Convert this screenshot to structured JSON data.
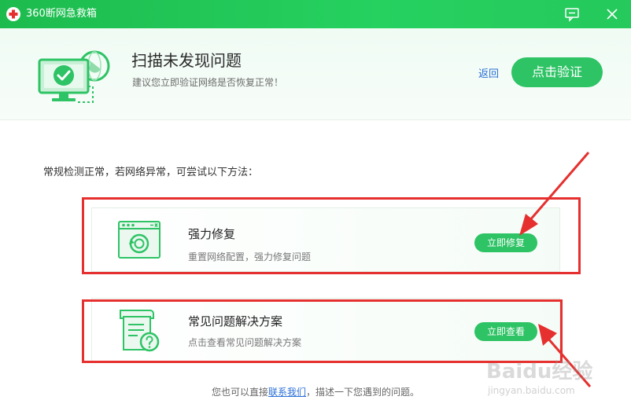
{
  "app": {
    "title": "360断网急救箱"
  },
  "header": {
    "title": "扫描未发现问题",
    "subtitle": "建议您立即验证网络是否恢复正常！",
    "back_label": "返回",
    "verify_label": "点击验证"
  },
  "main": {
    "intro": "常规检测正常，若网络异常，可尝试以下方法：",
    "cards": [
      {
        "title": "强力修复",
        "description": "重置网络配置，强力修复问题",
        "button_label": "立即修复",
        "icon": "repair-window-icon"
      },
      {
        "title": "常见问题解决方案",
        "description": "点击查看常见问题解决方案",
        "button_label": "立即查看",
        "icon": "faq-document-icon"
      }
    ]
  },
  "footer": {
    "prefix": "您也可以直接",
    "link_label": "联系我们",
    "suffix": "，描述一下您遇到的问题。"
  },
  "watermark": {
    "brand": "Baidu经验",
    "url": "jingyan.baidu.com"
  },
  "colors": {
    "accent": "#2ec365",
    "titlebar": "#22c85a",
    "annotation": "#e5302f",
    "link": "#2a6fd6"
  }
}
